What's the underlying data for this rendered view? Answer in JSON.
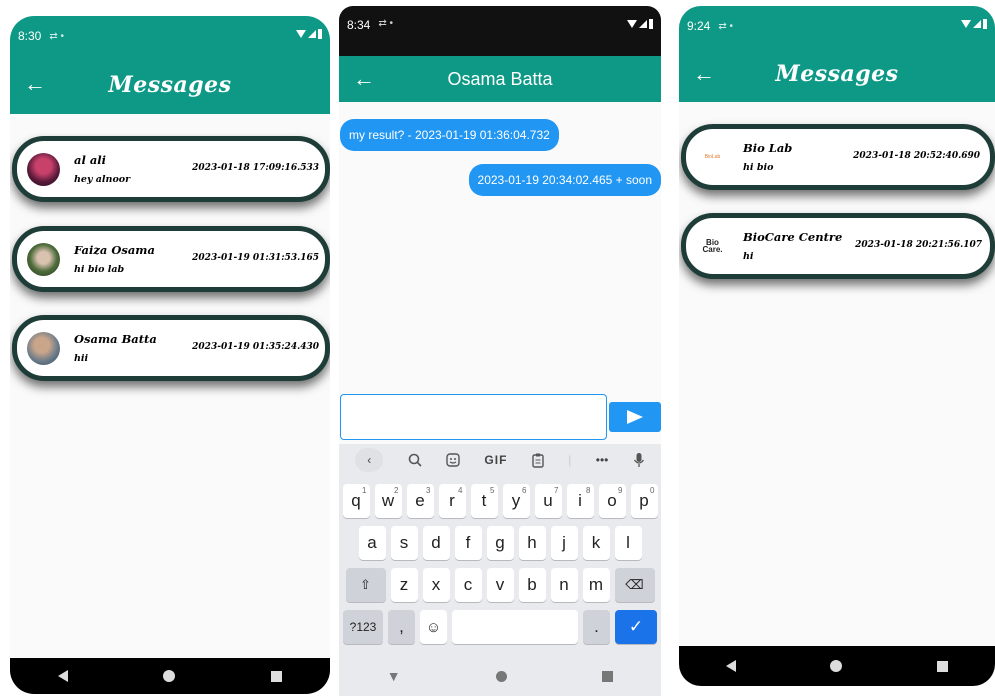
{
  "screen1": {
    "time": "8:30",
    "title": "Messages",
    "conversations": [
      {
        "name": "al ali",
        "message": "hey alnoor",
        "timestamp": "2023-01-18 17:09:16.533"
      },
      {
        "name": "Faiza Osama",
        "message": "hi bio lab",
        "timestamp": "2023-01-19 01:31:53.165"
      },
      {
        "name": "Osama Batta",
        "message": "hii",
        "timestamp": "2023-01-19 01:35:24.430"
      }
    ]
  },
  "screen2": {
    "time": "8:34",
    "title": "Osama Batta",
    "messages": [
      {
        "text": "my result? - 2023-01-19 01:36:04.732",
        "side": "left"
      },
      {
        "text": "2023-01-19 20:34:02.465 + soon",
        "side": "right"
      }
    ],
    "input_value": "",
    "keyboard": {
      "toolbar": [
        "‹",
        "search-icon",
        "emoji-icon",
        "GIF",
        "clipboard-icon",
        "•••",
        "mic-icon"
      ],
      "toolbar_gif": "GIF",
      "toolbar_more": "•••",
      "row1": [
        "q",
        "w",
        "e",
        "r",
        "t",
        "y",
        "u",
        "i",
        "o",
        "p"
      ],
      "row1_hints": [
        "1",
        "2",
        "3",
        "4",
        "5",
        "6",
        "7",
        "8",
        "9",
        "0"
      ],
      "row2": [
        "a",
        "s",
        "d",
        "f",
        "g",
        "h",
        "j",
        "k",
        "l"
      ],
      "row3": [
        "z",
        "x",
        "c",
        "v",
        "b",
        "n",
        "m"
      ],
      "symbols": "?123",
      "comma": ",",
      "period": "."
    }
  },
  "screen3": {
    "time": "9:24",
    "title": "Messages",
    "conversations": [
      {
        "name": "Bio Lab",
        "message": "hi bio",
        "timestamp": "2023-01-18 20:52:40.690",
        "logo": "BioLab"
      },
      {
        "name": "BioCare Centre",
        "message": "hi",
        "timestamp": "2023-01-18 20:21:56.107",
        "logo": "Bio Care."
      }
    ]
  },
  "colors": {
    "teal": "#0e9986",
    "blue": "#2196f3",
    "card_border": "#1f3d38"
  }
}
